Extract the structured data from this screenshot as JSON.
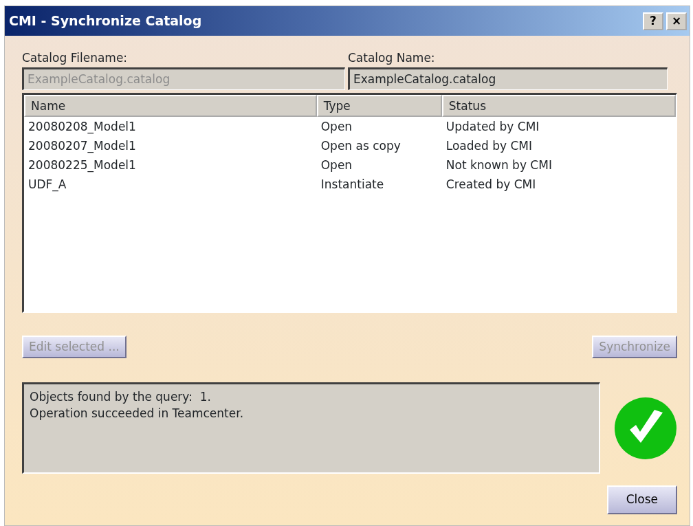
{
  "window": {
    "title": "CMI - Synchronize Catalog",
    "title_buttons": [
      "?",
      "×"
    ]
  },
  "fields": [
    {
      "label": "Catalog Filename:",
      "value": "ExampleCatalog.catalog",
      "disabled": true
    },
    {
      "label": "Catalog Name:",
      "value": "ExampleCatalog.catalog",
      "disabled": false
    }
  ],
  "table": {
    "columns": [
      "Name",
      "Type",
      "Status"
    ],
    "rows": [
      [
        "20080208_Model1",
        "Open",
        "Updated by CMI"
      ],
      [
        "20080207_Model1",
        "Open as copy",
        "Loaded by CMI"
      ],
      [
        "20080225_Model1",
        "Open",
        "Not known by CMI"
      ],
      [
        "UDF_A",
        "Instantiate",
        "Created by CMI"
      ]
    ]
  },
  "actions": [
    {
      "label": "Edit selected ...",
      "disabled": true
    },
    {
      "label": "Synchronize",
      "disabled": true
    }
  ],
  "messages": [
    "Objects found by the query:  1.",
    "Operation succeeded in Teamcenter."
  ],
  "result": {
    "kind": "success"
  },
  "buttons": [
    {
      "label": "Close",
      "disabled": false
    }
  ]
}
